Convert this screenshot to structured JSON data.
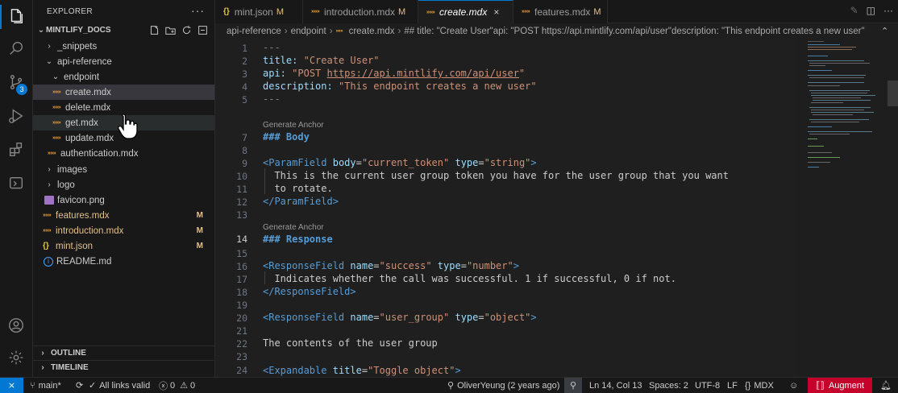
{
  "activity_bar": {
    "icons": [
      "files-icon",
      "search-icon",
      "source-control-icon",
      "run-debug-icon",
      "extensions-icon",
      "remote-explorer-icon",
      "account-icon",
      "settings-gear-icon"
    ],
    "source_control_badge": "3"
  },
  "sidebar": {
    "header": "EXPLORER",
    "workspace": "MINTLIFY_DOCS",
    "tree": [
      {
        "label": "_snippets",
        "kind": "folder",
        "expanded": false
      },
      {
        "label": "api-reference",
        "kind": "folder",
        "expanded": true
      },
      {
        "label": "endpoint",
        "kind": "folder",
        "expanded": true
      },
      {
        "label": "create.mdx",
        "kind": "mdx"
      },
      {
        "label": "delete.mdx",
        "kind": "mdx"
      },
      {
        "label": "get.mdx",
        "kind": "mdx"
      },
      {
        "label": "update.mdx",
        "kind": "mdx"
      },
      {
        "label": "authentication.mdx",
        "kind": "mdx"
      },
      {
        "label": "images",
        "kind": "folder",
        "expanded": false
      },
      {
        "label": "logo",
        "kind": "folder",
        "expanded": false
      },
      {
        "label": "favicon.png",
        "kind": "png"
      },
      {
        "label": "features.mdx",
        "kind": "mdx",
        "status": "M"
      },
      {
        "label": "introduction.mdx",
        "kind": "mdx",
        "status": "M"
      },
      {
        "label": "mint.json",
        "kind": "json",
        "status": "M"
      },
      {
        "label": "README.md",
        "kind": "md"
      }
    ],
    "outline": "OUTLINE",
    "timeline": "TIMELINE"
  },
  "tabs": [
    {
      "icon": "{}",
      "label": "mint.json",
      "status": "M"
    },
    {
      "icon": "mdx",
      "label": "introduction.mdx",
      "status": "M"
    },
    {
      "icon": "mdx",
      "label": "create.mdx",
      "close": "×",
      "active": true
    },
    {
      "icon": "mdx",
      "label": "features.mdx",
      "status": "M"
    }
  ],
  "breadcrumb": {
    "parts": [
      "api-reference",
      "endpoint",
      "create.mdx"
    ],
    "symbol": "## title: \"Create User\"api: \"POST https://api.mintlify.com/api/user\"description: \"This endpoint creates a new user\""
  },
  "editor": {
    "current_line": 14,
    "code_lens": "Generate Anchor",
    "lines": {
      "l1": "---",
      "l2_key": "title:",
      "l2_val": "\"Create User\"",
      "l3_key": "api:",
      "l3_val_a": "\"POST ",
      "l3_link": "https://api.mintlify.com/api/user",
      "l3_val_b": "\"",
      "l4_key": "description:",
      "l4_val": "\"This endpoint creates a new user\"",
      "l5": "---",
      "l7": "### Body",
      "l9_tag": "<ParamField",
      "l9_attr1": "body",
      "l9_val1": "\"current_token\"",
      "l9_attr2": "type",
      "l9_val2": "\"string\"",
      "l10": "  This is the current user group token you have for the user group that you want",
      "l11": "  to rotate.",
      "l12": "</ParamField>",
      "l14": "### Response",
      "l16_tag": "<ResponseField",
      "l16_attr1": "name",
      "l16_val1": "\"success\"",
      "l16_attr2": "type",
      "l16_val2": "\"number\"",
      "l17": "  Indicates whether the call was successful. 1 if successful, 0 if not.",
      "l18": "</ResponseField>",
      "l20_tag": "<ResponseField",
      "l20_attr1": "name",
      "l20_val1": "\"user_group\"",
      "l20_attr2": "type",
      "l20_val2": "\"object\"",
      "l22": "The contents of the user group",
      "l24_tag": "<Expandable",
      "l24_attr1": "title",
      "l24_val1": "\"Toggle object\""
    },
    "line_numbers": [
      "1",
      "2",
      "3",
      "4",
      "5",
      "7",
      "8",
      "9",
      "10",
      "11",
      "12",
      "13",
      "14",
      "15",
      "16",
      "17",
      "18",
      "19",
      "20",
      "21",
      "22",
      "23",
      "24"
    ]
  },
  "status_bar": {
    "branch": "main*",
    "links": "All links valid",
    "errors": "0",
    "warnings": "0",
    "blame": "OliverYeung (2 years ago)",
    "position": "Ln 14, Col 13",
    "spaces": "Spaces: 2",
    "encoding": "UTF-8",
    "eol": "LF",
    "language": "MDX",
    "augment": "Augment"
  },
  "colors": {
    "accent": "#0078d4",
    "modified": "#e2c08d",
    "augment": "#c4002b"
  }
}
